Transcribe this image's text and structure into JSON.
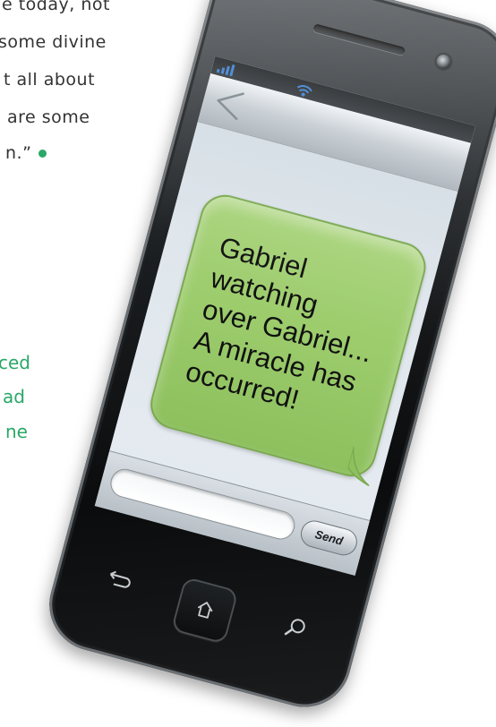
{
  "article": {
    "lines": [
      "e today, not",
      "some divine",
      "t all about",
      "are some",
      "n.”"
    ],
    "green_lines": [
      "ced",
      "ad",
      "ne"
    ]
  },
  "phone": {
    "message": {
      "lines": [
        "Gabriel",
        "watching",
        "over Gabriel...",
        "A miracle has",
        "occurred!"
      ]
    },
    "input": {
      "value": "",
      "placeholder": ""
    },
    "send_label": "Send",
    "icons": {
      "signal": "signal-bars-icon",
      "wifi": "wifi-icon",
      "back": "back-arrow-icon",
      "camera": "camera-icon",
      "return": "return-arrow-icon",
      "home": "home-icon",
      "search": "search-icon"
    }
  },
  "colors": {
    "bubble": "#9ccc6c",
    "accent_green": "#2aa868",
    "phone_body": "#1c1f22"
  }
}
